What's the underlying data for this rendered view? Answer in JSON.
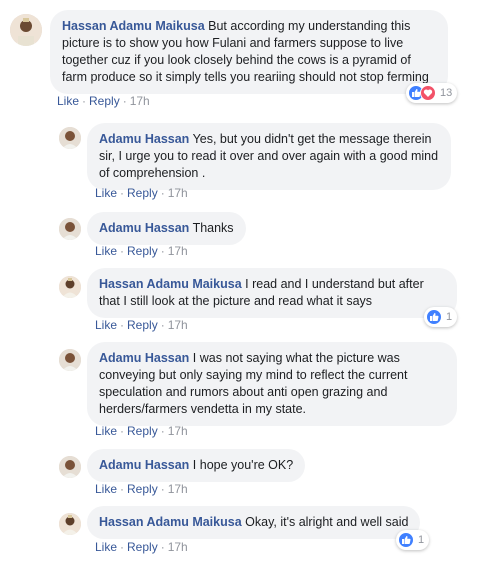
{
  "comments": [
    {
      "author": "Hassan Adamu Maikusa",
      "text": "But according my understanding this picture is to show you how Fulani and farmers suppose to live together cuz if you look closely behind the cows is a pyramid of farm produce so it simply tells you reariing should not stop ferming",
      "like": "Like",
      "reply": "Reply",
      "time": "17h",
      "reaction_count": "13"
    },
    {
      "author": "Adamu Hassan",
      "text": "Yes, but you didn't get the message therein sir, I urge you to read it over and over again with a good mind of comprehension .",
      "like": "Like",
      "reply": "Reply",
      "time": "17h"
    },
    {
      "author": "Adamu Hassan",
      "text": "Thanks",
      "like": "Like",
      "reply": "Reply",
      "time": "17h"
    },
    {
      "author": "Hassan Adamu Maikusa",
      "text": "I read and I understand but after that I still look at the picture and read what it says",
      "like": "Like",
      "reply": "Reply",
      "time": "17h",
      "reaction_count": "1"
    },
    {
      "author": "Adamu Hassan",
      "text": "I was not saying what the picture was conveying but only saying my mind to reflect the current speculation and rumors about anti open grazing and herders/farmers vendetta in my state.",
      "like": "Like",
      "reply": "Reply",
      "time": "17h"
    },
    {
      "author": "Adamu Hassan",
      "text": "I hope you're OK?",
      "like": "Like",
      "reply": "Reply",
      "time": "17h"
    },
    {
      "author": "Hassan Adamu Maikusa",
      "text": "Okay, it's alright and well said",
      "like": "Like",
      "reply": "Reply",
      "time": "17h",
      "reaction_count": "1"
    }
  ],
  "colors": {
    "author_link": "#385898",
    "bubble_bg": "#f2f3f5",
    "like_reaction": "#4080ff",
    "love_reaction": "#f25268"
  },
  "icons": {
    "like_reaction": "thumbs-up-icon",
    "love_reaction": "heart-icon"
  }
}
